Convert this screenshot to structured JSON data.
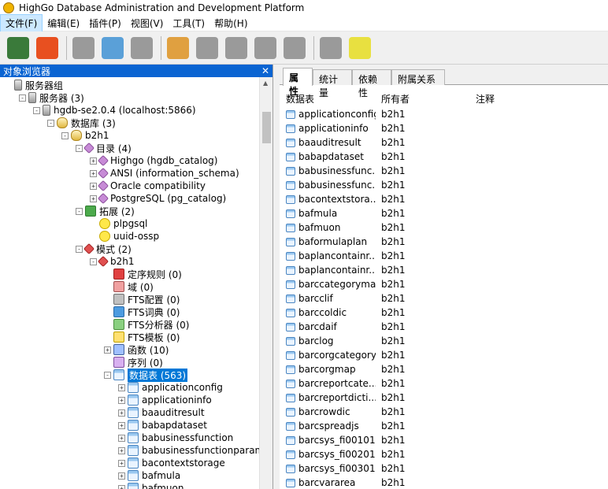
{
  "window": {
    "title": "HighGo Database Administration and Development Platform"
  },
  "menu": [
    "文件(F)",
    "编辑(E)",
    "插件(P)",
    "视图(V)",
    "工具(T)",
    "帮助(H)"
  ],
  "toolbar": {
    "buttons": [
      {
        "name": "connect-icon",
        "color": "#3a7a3a"
      },
      {
        "name": "refresh-icon",
        "color": "#e85020"
      },
      {
        "name": "properties-icon",
        "color": "#9a9a9a"
      },
      {
        "name": "move-icon",
        "color": "#5aa0d8"
      },
      {
        "name": "delete-icon",
        "color": "#9a9a9a"
      },
      {
        "name": "sql-query-icon",
        "color": "#e0a040"
      },
      {
        "name": "view-data-icon",
        "color": "#9a9a9a"
      },
      {
        "name": "filter-data-icon",
        "color": "#9a9a9a"
      },
      {
        "name": "wrench-icon",
        "color": "#9a9a9a"
      },
      {
        "name": "plugin-icon",
        "color": "#9a9a9a"
      },
      {
        "name": "hint-icon",
        "color": "#9a9a9a"
      },
      {
        "name": "help-icon",
        "color": "#e8e040"
      }
    ]
  },
  "object_browser": {
    "title": "对象浏览器",
    "close": "✕",
    "tree": [
      {
        "label": "服务器组",
        "icon": "server-group-icon",
        "cls": "i-server",
        "depth": 0,
        "exp": ""
      },
      {
        "label": "服务器 (3)",
        "icon": "server-icon",
        "cls": "i-server",
        "depth": 1,
        "exp": "-"
      },
      {
        "label": "hgdb-se2.0.4 (localhost:5866)",
        "icon": "server-instance-icon",
        "cls": "i-server",
        "depth": 2,
        "exp": "-"
      },
      {
        "label": "数据库 (3)",
        "icon": "databases-icon",
        "cls": "i-db",
        "depth": 3,
        "exp": "-"
      },
      {
        "label": "b2h1",
        "icon": "database-icon",
        "cls": "i-db",
        "depth": 4,
        "exp": "-"
      },
      {
        "label": "目录 (4)",
        "icon": "catalogs-icon",
        "cls": "i-cat",
        "depth": 5,
        "exp": "-"
      },
      {
        "label": "Highgo (hgdb_catalog)",
        "icon": "catalog-icon",
        "cls": "i-cat",
        "depth": 6,
        "exp": "+"
      },
      {
        "label": "ANSI (information_schema)",
        "icon": "catalog-icon",
        "cls": "i-cat",
        "depth": 6,
        "exp": "+"
      },
      {
        "label": "Oracle compatibility",
        "icon": "catalog-icon",
        "cls": "i-cat",
        "depth": 6,
        "exp": "+"
      },
      {
        "label": "PostgreSQL (pg_catalog)",
        "icon": "catalog-icon",
        "cls": "i-cat",
        "depth": 6,
        "exp": "+"
      },
      {
        "label": "拓展 (2)",
        "icon": "extensions-icon",
        "cls": "i-ext",
        "depth": 5,
        "exp": "-"
      },
      {
        "label": "plpgsql",
        "icon": "extension-bulb-icon",
        "cls": "i-bulb",
        "depth": 6,
        "exp": ""
      },
      {
        "label": "uuid-ossp",
        "icon": "extension-bulb-icon",
        "cls": "i-bulb",
        "depth": 6,
        "exp": ""
      },
      {
        "label": "模式 (2)",
        "icon": "schemas-icon",
        "cls": "i-schema",
        "depth": 5,
        "exp": "-"
      },
      {
        "label": "b2h1",
        "icon": "schema-icon",
        "cls": "i-schema",
        "depth": 6,
        "exp": "-"
      },
      {
        "label": "定序规则 (0)",
        "icon": "collation-icon",
        "cls": "i-red",
        "depth": 7,
        "exp": ""
      },
      {
        "label": "域 (0)",
        "icon": "domain-icon",
        "cls": "i-home",
        "depth": 7,
        "exp": ""
      },
      {
        "label": "FTS配置 (0)",
        "icon": "fts-config-icon",
        "cls": "i-fts",
        "depth": 7,
        "exp": ""
      },
      {
        "label": "FTS词典 (0)",
        "icon": "fts-dictionary-icon",
        "cls": "i-blue",
        "depth": 7,
        "exp": ""
      },
      {
        "label": "FTS分析器 (0)",
        "icon": "fts-parser-icon",
        "cls": "i-green",
        "depth": 7,
        "exp": ""
      },
      {
        "label": "FTS模板 (0)",
        "icon": "fts-template-icon",
        "cls": "i-yellow",
        "depth": 7,
        "exp": ""
      },
      {
        "label": "函数 (10)",
        "icon": "functions-icon",
        "cls": "i-func",
        "depth": 7,
        "exp": "+"
      },
      {
        "label": "序列 (0)",
        "icon": "sequence-icon",
        "cls": "i-seq",
        "depth": 7,
        "exp": ""
      },
      {
        "label": "数据表 (563)",
        "icon": "tables-icon",
        "cls": "i-table",
        "depth": 7,
        "exp": "-",
        "selected": true
      },
      {
        "label": "applicationconfig",
        "icon": "table-icon",
        "cls": "i-table",
        "depth": 8,
        "exp": "+"
      },
      {
        "label": "applicationinfo",
        "icon": "table-icon",
        "cls": "i-table",
        "depth": 8,
        "exp": "+"
      },
      {
        "label": "baauditresult",
        "icon": "table-icon",
        "cls": "i-table",
        "depth": 8,
        "exp": "+"
      },
      {
        "label": "babapdataset",
        "icon": "table-icon",
        "cls": "i-table",
        "depth": 8,
        "exp": "+"
      },
      {
        "label": "babusinessfunction",
        "icon": "table-icon",
        "cls": "i-table",
        "depth": 8,
        "exp": "+"
      },
      {
        "label": "babusinessfunctionparamete",
        "icon": "table-icon",
        "cls": "i-table",
        "depth": 8,
        "exp": "+"
      },
      {
        "label": "bacontextstorage",
        "icon": "table-icon",
        "cls": "i-table",
        "depth": 8,
        "exp": "+"
      },
      {
        "label": "bafmula",
        "icon": "table-icon",
        "cls": "i-table",
        "depth": 8,
        "exp": "+"
      },
      {
        "label": "bafmuon",
        "icon": "table-icon",
        "cls": "i-table",
        "depth": 8,
        "exp": "+"
      }
    ]
  },
  "detail": {
    "tabs": [
      "属性",
      "统计量",
      "依赖性",
      "附属关系"
    ],
    "active_tab": 0,
    "columns": [
      "数据表",
      "所有者",
      "注释"
    ],
    "rows": [
      [
        "applicationconfig",
        "b2h1"
      ],
      [
        "applicationinfo",
        "b2h1"
      ],
      [
        "baauditresult",
        "b2h1"
      ],
      [
        "babapdataset",
        "b2h1"
      ],
      [
        "babusinessfunc...",
        "b2h1"
      ],
      [
        "babusinessfunc...",
        "b2h1"
      ],
      [
        "bacontextstora...",
        "b2h1"
      ],
      [
        "bafmula",
        "b2h1"
      ],
      [
        "bafmuon",
        "b2h1"
      ],
      [
        "baformulaplan",
        "b2h1"
      ],
      [
        "baplancontainr...",
        "b2h1"
      ],
      [
        "baplancontainr...",
        "b2h1"
      ],
      [
        "barccategorymap",
        "b2h1"
      ],
      [
        "barcclif",
        "b2h1"
      ],
      [
        "barccoldic",
        "b2h1"
      ],
      [
        "barcdaif",
        "b2h1"
      ],
      [
        "barclog",
        "b2h1"
      ],
      [
        "barcorgcategory",
        "b2h1"
      ],
      [
        "barcorgmap",
        "b2h1"
      ],
      [
        "barcreportcate...",
        "b2h1"
      ],
      [
        "barcreportdicti...",
        "b2h1"
      ],
      [
        "barcrowdic",
        "b2h1"
      ],
      [
        "barcspreadjs",
        "b2h1"
      ],
      [
        "barcsys_fi00101",
        "b2h1"
      ],
      [
        "barcsys_fi00201",
        "b2h1"
      ],
      [
        "barcsys_fi00301",
        "b2h1"
      ],
      [
        "barcvararea",
        "b2h1"
      ]
    ]
  }
}
